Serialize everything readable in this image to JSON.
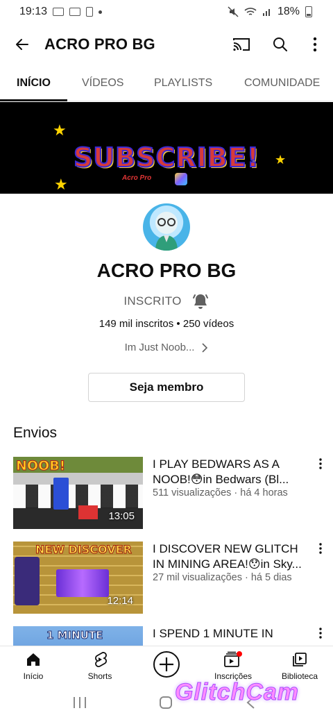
{
  "status_bar": {
    "time": "19:13",
    "battery": "18%"
  },
  "app_bar": {
    "title": "ACRO PRO BG"
  },
  "tabs": [
    {
      "label": "INÍCIO",
      "active": true
    },
    {
      "label": "VÍDEOS",
      "active": false
    },
    {
      "label": "PLAYLISTS",
      "active": false
    },
    {
      "label": "COMUNIDADE",
      "active": false
    }
  ],
  "banner": {
    "headline": "SUBSCRIBE!",
    "sub": "Acro Pro"
  },
  "channel": {
    "name": "ACRO PRO BG",
    "subscribe_state": "INSCRITO",
    "stats": "149 mil inscritos • 250 vídeos",
    "link": "Im Just Noob...",
    "member_button": "Seja membro"
  },
  "section": {
    "title": "Envios"
  },
  "videos": [
    {
      "title": "I PLAY BEDWARS AS A NOOB!😳in Bedwars (Bl...",
      "meta": "511 visualizações · há 4 horas",
      "duration": "13:05",
      "thumb_text": "NOOB!"
    },
    {
      "title": "I DISCOVER NEW GLITCH IN MINING AREA!😯in Sky...",
      "meta": "27 mil visualizações · há 5 dias",
      "duration": "12:14",
      "thumb_text": "NEW DISCOVER"
    },
    {
      "title": "I SPEND 1 MINUTE IN",
      "meta": "",
      "duration": "",
      "thumb_text": "1 MINUTE"
    }
  ],
  "bottom_nav": [
    {
      "label": "Início",
      "icon": "home-icon"
    },
    {
      "label": "Shorts",
      "icon": "shorts-icon"
    },
    {
      "label": "",
      "icon": "create-icon"
    },
    {
      "label": "Inscrições",
      "icon": "subscriptions-icon"
    },
    {
      "label": "Biblioteca",
      "icon": "library-icon"
    }
  ],
  "watermark": "GlitchCam",
  "colors": {
    "accent": "#0f0f0f",
    "notification": "#ff0000",
    "secondary_text": "#606060"
  }
}
